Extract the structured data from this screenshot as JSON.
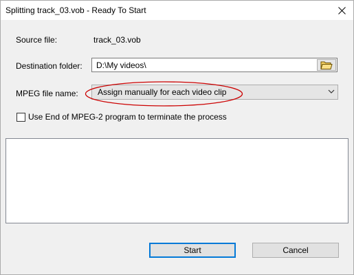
{
  "window": {
    "title": "Splitting track_03.vob - Ready To Start"
  },
  "source": {
    "label": "Source file:",
    "value": "track_03.vob"
  },
  "destination": {
    "label": "Destination folder:",
    "value": "D:\\My videos\\"
  },
  "mpeg_name": {
    "label": "MPEG file name:",
    "selected": "Assign manually for each video clip"
  },
  "options": {
    "end_of_program_label": "Use End of MPEG-2 program to terminate the process",
    "end_of_program_checked": false
  },
  "log": {
    "content": ""
  },
  "buttons": {
    "start": "Start",
    "cancel": "Cancel"
  },
  "colors": {
    "accent": "#0078d7",
    "highlight_ellipse": "#cc0000",
    "folder_icon": "#f6d365"
  },
  "icons": {
    "close": "close-icon",
    "browse": "folder-icon",
    "dropdown": "chevron-down-icon"
  }
}
